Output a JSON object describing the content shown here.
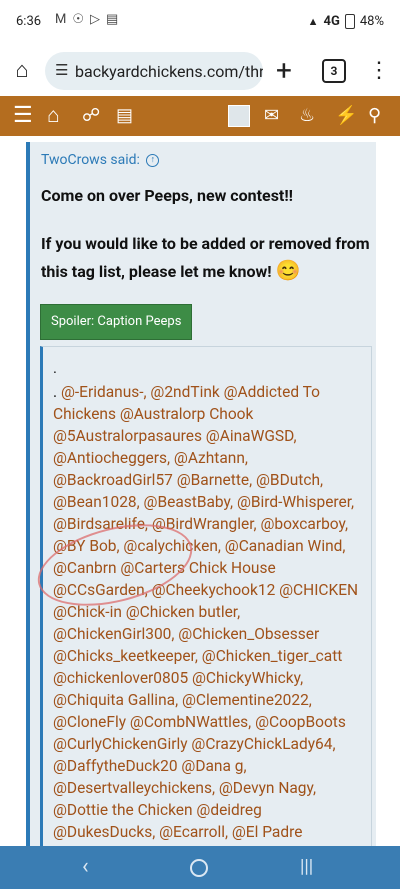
{
  "status": {
    "time": "6:36",
    "icons_left": [
      "M",
      "☉",
      "▷",
      "▤"
    ],
    "signal": "4G",
    "battery": "48%"
  },
  "browser": {
    "url": "backyardchickens.com/thre",
    "tab_count": "3"
  },
  "quote": {
    "author": "TwoCrows said:",
    "line1": "Come on over Peeps, new contest!!",
    "line2": "If you would like to be added or removed from this tag list, please let me know!",
    "emoji": "😊"
  },
  "spoiler": {
    "button_label": "Spoiler: Caption Peeps",
    "dot": ".",
    "lead": ". ",
    "tags": "@-Eridanus-, @2ndTink @Addicted To Chickens @Australorp Chook @5Australorpasaures @AinaWGSD, @Antiocheggers, @Azhtann, @BackroadGirl57 @Barnette, @BDutch, @Bean1028, @BeastBaby, @Bird-Whisperer, @Birdsarelife, @BirdWrangler, @boxcarboy, @BY Bob, @calychicken, @Canadian Wind, @Canbrn @Carters Chick House @CCsGarden, @Cheekychook12 @CHICKEN @Chick-in @Chicken butler, @ChickenGirl300, @Chicken_Obsesser @Chicks_keetkeeper, @Chicken_tiger_catt @chickenlover0805 @ChickyWhicky, @Chiquita Gallina, @Clementine2022, @CloneFly @CombNWattles, @CoopBoots @CurlyChickenGirly @CrazyChickLady64, @DaffytheDuck20 @Dana g, @Desertvalleychickens, @Devyn Nagy, @Dottie the Chicken @deidreg @DukesDucks, @Ecarroll, @El Padre @GGere, @Flopeth Dinsmore"
  },
  "colors": {
    "nav": "#b46d1f",
    "quote_border": "#2c7ab7",
    "link": "#a0521a",
    "spoiler_button": "#3d8c46",
    "system_nav": "#3a7db3"
  }
}
